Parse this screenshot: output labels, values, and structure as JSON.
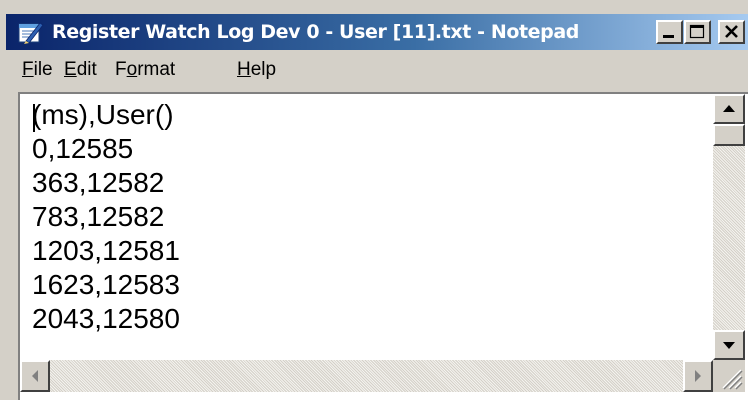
{
  "window": {
    "title": "Register Watch Log Dev 0 - User [11].txt - Notepad",
    "icon": "notepad-icon"
  },
  "title_buttons": {
    "minimize": "minimize-icon",
    "maximize": "maximize-icon",
    "close": "close-icon"
  },
  "menu": {
    "file": {
      "underline": "F",
      "rest": "ile"
    },
    "edit": {
      "underline": "E",
      "rest": "dit"
    },
    "format": {
      "pre": "F",
      "underline": "o",
      "rest": "rmat"
    },
    "help": {
      "underline": "H",
      "rest": "elp"
    }
  },
  "editor": {
    "lines": [
      "(ms),User()",
      "0,12585",
      "363,12582",
      "783,12582",
      "1203,12581",
      "1623,12583",
      "2043,12580"
    ]
  },
  "scrollbars": {
    "vertical": {
      "up": "scroll-up-arrow-icon",
      "down": "scroll-down-arrow-icon"
    },
    "horizontal": {
      "left": "scroll-left-arrow-icon",
      "right": "scroll-right-arrow-icon"
    }
  },
  "colors": {
    "title_gradient_start": "#0a246a",
    "title_gradient_end": "#a6caf0",
    "chrome": "#d4d0c8",
    "text": "#000000"
  }
}
